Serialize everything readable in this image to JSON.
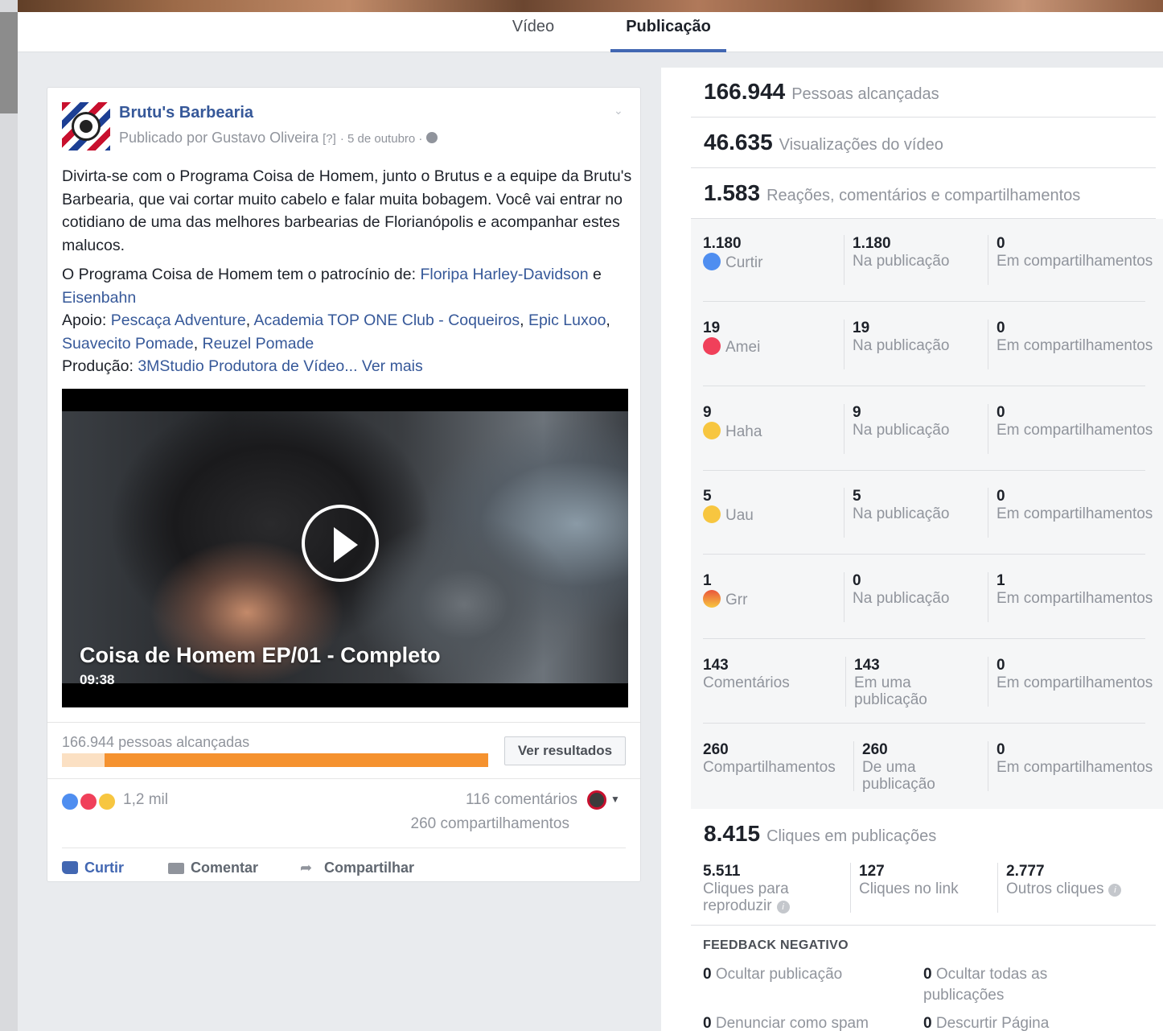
{
  "tabs": [
    {
      "label": "Vídeo",
      "active": false
    },
    {
      "label": "Publicação",
      "active": true
    }
  ],
  "post": {
    "page_name": "Brutu's Barbearia",
    "meta_author": "Publicado por Gustavo Oliveira",
    "meta_help": "[?]",
    "meta_date": "· 5 de outubro ·",
    "body": {
      "p1": "Divirta-se com o Programa Coisa de Homem, junto o Brutus e a equipe da Brutu's Barbearia, que vai cortar muito cabelo e falar muita bobagem. Você vai entrar no cotidiano de uma das melhores barbearias de Florianópolis e acompanhar estes malucos.",
      "sponsor_prefix": "O Programa Coisa de Homem tem o patrocínio de: ",
      "sponsor_link1": "Floripa Harley-Davidson",
      "sponsor_and": " e ",
      "sponsor_link2": "Eisenbahn",
      "support_prefix": "Apoio: ",
      "support_link1": "Pescaça Adventure",
      "support_link2": "Academia TOP ONE Club - Coqueiros",
      "support_link3": "Epic Luxoo",
      "support_link4": "Suavecito Pomade",
      "support_link5": "Reuzel Pomade",
      "comma": ", ",
      "production_prefix": "Produção: ",
      "production_link": "3MStudio Produtora de Vídeo...",
      "see_more": "Ver mais"
    },
    "video": {
      "title": "Coisa de Homem EP/01 - Completo",
      "duration": "09:38"
    },
    "reach_text": "166.944 pessoas alcançadas",
    "reach_fraction": 0.9,
    "results_button": "Ver resultados",
    "reactions_count": "1,2 mil",
    "comments_count": "116 comentários",
    "shares_count": "260 compartilhamentos",
    "actions": {
      "like": "Curtir",
      "comment": "Comentar",
      "share": "Compartilhar"
    }
  },
  "stats": {
    "reach": {
      "value": "166.944",
      "label": "Pessoas alcançadas"
    },
    "views": {
      "value": "46.635",
      "label": "Visualizações do vídeo"
    },
    "engagement": {
      "value": "1.583",
      "label": "Reações, comentários e compartilhamentos"
    },
    "rows": [
      {
        "icon": "like-icon",
        "total": "1.180",
        "name": "Curtir",
        "on_post": "1.180",
        "on_post_label": "Na publicação",
        "on_shares": "0",
        "on_shares_label": "Em compartilhamentos"
      },
      {
        "icon": "love-icon",
        "total": "19",
        "name": "Amei",
        "on_post": "19",
        "on_post_label": "Na publicação",
        "on_shares": "0",
        "on_shares_label": "Em compartilhamentos"
      },
      {
        "icon": "haha-icon",
        "total": "9",
        "name": "Haha",
        "on_post": "9",
        "on_post_label": "Na publicação",
        "on_shares": "0",
        "on_shares_label": "Em compartilhamentos"
      },
      {
        "icon": "wow-icon",
        "total": "5",
        "name": "Uau",
        "on_post": "5",
        "on_post_label": "Na publicação",
        "on_shares": "0",
        "on_shares_label": "Em compartilhamentos"
      },
      {
        "icon": "angry-icon",
        "total": "1",
        "name": "Grr",
        "on_post": "0",
        "on_post_label": "Na publicação",
        "on_shares": "1",
        "on_shares_label": "Em compartilhamentos"
      },
      {
        "icon": "",
        "total": "143",
        "name": "Comentários",
        "on_post": "143",
        "on_post_label": "Em uma publicação",
        "on_shares": "0",
        "on_shares_label": "Em compartilhamentos"
      },
      {
        "icon": "",
        "total": "260",
        "name": "Compartilhamentos",
        "on_post": "260",
        "on_post_label": "De uma publicação",
        "on_shares": "0",
        "on_shares_label": "Em compartilhamentos"
      }
    ],
    "clicks": {
      "value": "8.415",
      "label": "Cliques em publicações"
    },
    "click_breakdown": [
      {
        "value": "5.511",
        "label": "Cliques para reproduzir"
      },
      {
        "value": "127",
        "label": "Cliques no link"
      },
      {
        "value": "2.777",
        "label": "Outros cliques"
      }
    ],
    "negative_title": "FEEDBACK NEGATIVO",
    "negative": [
      {
        "value": "0",
        "label": "Ocultar publicação"
      },
      {
        "value": "0",
        "label": "Ocultar todas as publicações"
      },
      {
        "value": "0",
        "label": "Denunciar como spam"
      },
      {
        "value": "0",
        "label": "Descurtir Página"
      }
    ]
  },
  "colors": {
    "accent": "#4267b2",
    "link": "#365899",
    "reach_bar": "#f5922f",
    "muted_text": "#90949c"
  }
}
